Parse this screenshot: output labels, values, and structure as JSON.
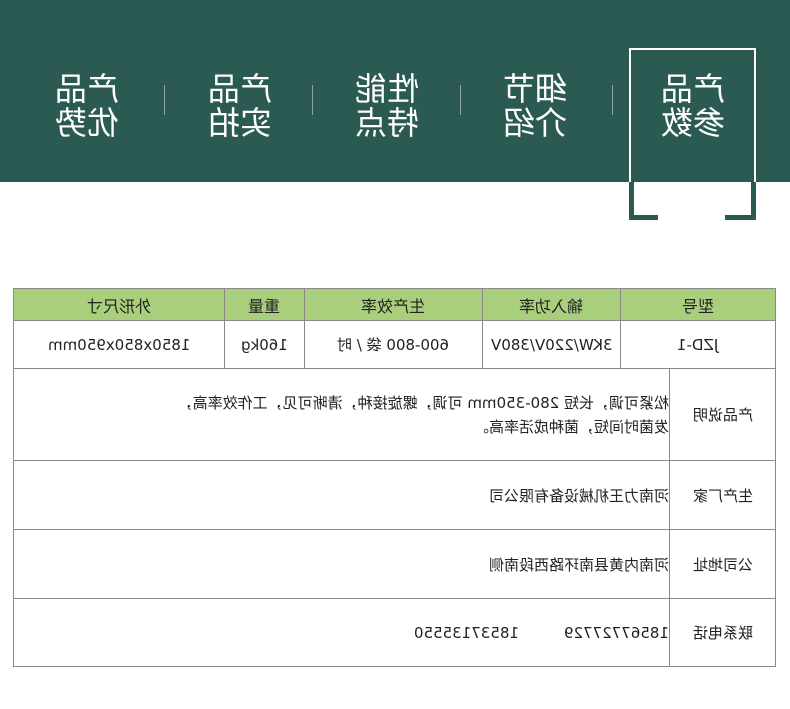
{
  "nav": {
    "tabs": [
      {
        "line1": "产品",
        "line2": "优势"
      },
      {
        "line1": "产品",
        "line2": "实拍"
      },
      {
        "line1": "性能",
        "line2": "特点"
      },
      {
        "line1": "细节",
        "line2": "介绍"
      },
      {
        "line1": "产品",
        "line2": "参数",
        "active": true
      }
    ]
  },
  "colors": {
    "banner": "#2a5a52",
    "header_row": "#a9cf7d",
    "border": "#8a8a8a"
  },
  "spec_table": {
    "headers": {
      "model": "型号",
      "power": "输入功率",
      "efficiency": "生产效率",
      "weight": "重量",
      "size": "外形尺寸"
    },
    "values": {
      "model": "JZD-1",
      "power": "3KW/220V/380V",
      "efficiency": "600-800 袋 / 时",
      "weight": "160kg",
      "size": "1850x850x950mm"
    },
    "rows": {
      "description": {
        "label": "产品说明",
        "line1": "松紧可调，长短 280-350mm 可调，螺旋接种，清晰可见，工作效率高，",
        "line2": "发菌时间短，菌种成活率高。"
      },
      "manufacturer": {
        "label": "生产厂家",
        "value": "河南力王机械设备有限公司"
      },
      "address": {
        "label": "公司地址",
        "value": "河南内黄县南环路西段南侧"
      },
      "phone": {
        "label": "联系电话",
        "value": "18567727729　　　18537135550"
      }
    }
  }
}
